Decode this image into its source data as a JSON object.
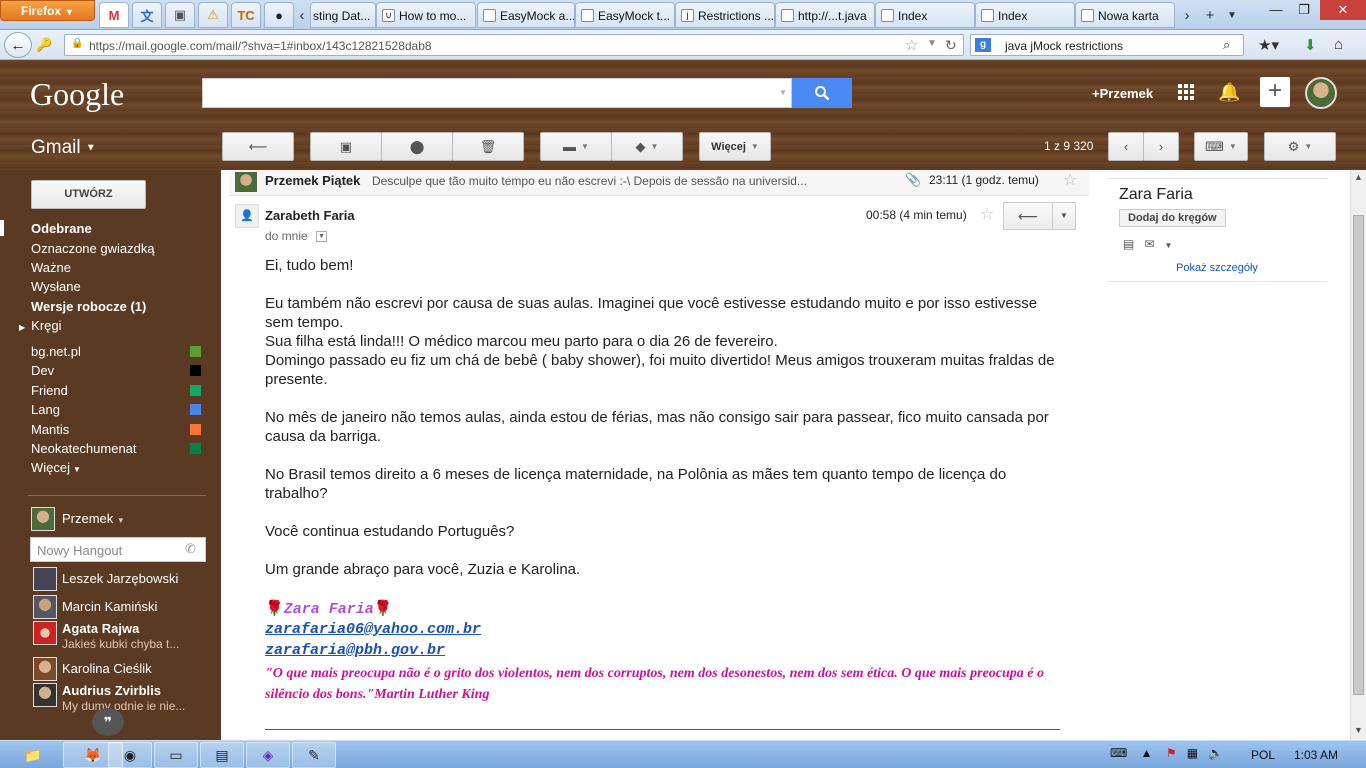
{
  "browser": {
    "menu_label": "Firefox",
    "tabs": [
      {
        "label": "sting Dat...",
        "icon": "page-icon"
      },
      {
        "label": "How to mo...",
        "icon": "stackoverflow-icon"
      },
      {
        "label": "EasyMock a...",
        "icon": "page-icon"
      },
      {
        "label": "EasyMock t...",
        "icon": "page-icon"
      },
      {
        "label": "Restrictions ...",
        "icon": "jboss-icon"
      },
      {
        "label": "http://...t.java",
        "icon": "page-icon"
      },
      {
        "label": "Index",
        "icon": "page-icon"
      },
      {
        "label": "Index",
        "icon": "page-icon"
      },
      {
        "label": "Nowa karta",
        "icon": "page-icon"
      }
    ],
    "url": "https://mail.google.com/mail/?shva=1#inbox/143c12821528dab8",
    "search_text": "java jMock restrictions",
    "search_engine_label": "g"
  },
  "gmail": {
    "logo": "Google",
    "app_label": "Gmail",
    "user_plus": "+Przemek",
    "more_label": "Więcej",
    "count": "1 z 9 320",
    "compose": "UTWÓRZ",
    "nav": {
      "inbox": "Odebrane",
      "starred": "Oznaczone gwiazdką",
      "important": "Ważne",
      "sent": "Wysłane",
      "drafts": "Wersje robocze (1)",
      "circles": "Kręgi",
      "more": "Więcej"
    },
    "labels": [
      {
        "name": "bg.net.pl",
        "color": "#5e9e2e"
      },
      {
        "name": "Dev",
        "color": "#000000"
      },
      {
        "name": "Friend",
        "color": "#16a765"
      },
      {
        "name": "Lang",
        "color": "#4a86e8"
      },
      {
        "name": "Mantis",
        "color": "#ff7537"
      },
      {
        "name": "Neokatechumenat",
        "color": "#0b804b"
      }
    ],
    "hangouts": {
      "me": "Przemek",
      "placeholder": "Nowy Hangout",
      "contacts": [
        {
          "name": "Leszek Jarzębowski",
          "status": ""
        },
        {
          "name": "Marcin Kamiński",
          "status": ""
        },
        {
          "name": "Agata Rajwa",
          "status": "Jakieś kubki chyba t..."
        },
        {
          "name": "Karolina Cieślik",
          "status": ""
        },
        {
          "name": "Audrius Zvirblis",
          "status": "My dumy odnie ie nie..."
        }
      ]
    }
  },
  "thread": {
    "collapsed": {
      "from": "Przemek Piątek",
      "snippet": "Desculpe que tão muito tempo eu não escrevi :-\\ Depois de sessão na universid...",
      "time": "23:11 (1 godz. temu)"
    },
    "message": {
      "from": "Zarabeth Faria",
      "to": "do mnie",
      "time": "00:58 (4 min temu)",
      "paragraphs": [
        "Ei, tudo bem!",
        "Eu também não escrevi por causa de suas aulas. Imaginei que você estivesse estudando muito e por isso estivesse sem tempo.\nSua filha está linda!!! O médico marcou meu parto para o dia 26 de fevereiro.\nDomingo passado eu fiz um chá de bebê ( baby shower), foi muito divertido! Meus amigos trouxeram muitas fraldas de presente.",
        "No mês de janeiro não temos aulas, ainda estou de férias, mas não consigo sair para passear, fico muito cansada por causa da barriga.",
        "No Brasil temos direito a 6 meses de licença maternidade, na Polônia as mães tem quanto tempo de licença do trabalho?",
        "Você continua estudando Português?",
        "Um grande abraço para você, Zuzia e Karolina."
      ],
      "signature": {
        "name": "Zara Faria",
        "email1": "zarafaria06@yahoo.com.br",
        "email2": "zarafaria@pbh.gov.br",
        "quote": "\"O que mais preocupa não é o grito dos violentos, nem dos corruptos, nem dos desonestos, nem dos sem ética. O que mais preocupa é o silêncio dos bons.\"Martin Luther King"
      }
    }
  },
  "contact_panel": {
    "name": "Zara Faria",
    "add_button": "Dodaj do kręgów",
    "details_link": "Pokaż szczegóły"
  },
  "taskbar": {
    "lang": "POL",
    "time": "1:03 AM"
  },
  "colors": {
    "search_blue": "#4a8af4",
    "signature_purple": "#b14fd8",
    "signature_link": "#1a50b8",
    "quote_magenta": "#c8129a"
  }
}
